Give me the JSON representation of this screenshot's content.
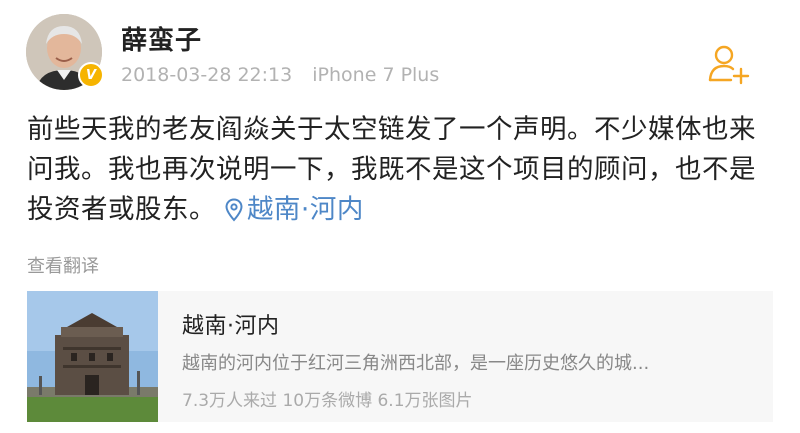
{
  "post": {
    "username": "薛蛮子",
    "timestamp": "2018-03-28 22:13",
    "device": "iPhone 7 Plus",
    "verified_badge": "V",
    "follow_icon": "add-user-icon",
    "text": "前些天我的老友阎焱关于太空链发了一个声明。不少媒体也来问我。我也再次说明一下，我既不是这个项目的顾问，也不是投资者或股东。",
    "location_link": "越南·河内",
    "translate_label": "查看翻译"
  },
  "location_card": {
    "title": "越南·河内",
    "description": "越南的河内位于红河三角洲西北部，是一座历史悠久的城...",
    "stats": "7.3万人来过  10万条微博  6.1万张图片"
  },
  "colors": {
    "link": "#4e87c7",
    "follow_icon": "#f5a623",
    "badge": "#f6b400"
  }
}
